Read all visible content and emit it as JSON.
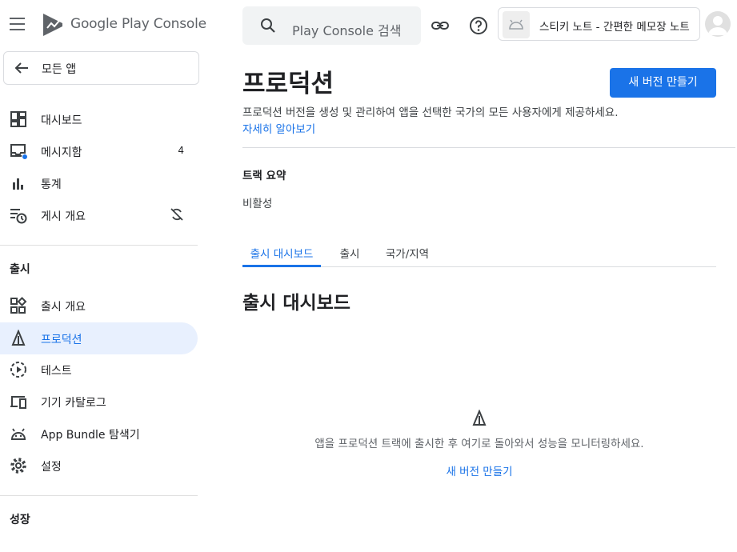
{
  "brand": {
    "name": "Google Play Console"
  },
  "sidebar": {
    "all_apps_label": "모든 앱",
    "top_items": [
      {
        "label": "대시보드",
        "icon": "dashboard-icon"
      },
      {
        "label": "메시지함",
        "icon": "inbox-icon",
        "badge": "4"
      },
      {
        "label": "통계",
        "icon": "bar-chart-icon"
      },
      {
        "label": "게시 개요",
        "icon": "publishing-overview-icon",
        "trailing_icon": "sync-off-icon"
      }
    ],
    "release_section_label": "출시",
    "release_items": [
      {
        "label": "출시 개요",
        "icon": "release-overview-icon"
      },
      {
        "label": "프로덕션",
        "icon": "production-icon",
        "active": true
      },
      {
        "label": "테스트",
        "icon": "testing-icon"
      },
      {
        "label": "기기 카탈로그",
        "icon": "device-catalog-icon"
      },
      {
        "label": "App Bundle 탐색기",
        "icon": "android-icon"
      },
      {
        "label": "설정",
        "icon": "settings-icon"
      }
    ],
    "growth_section_label": "성장"
  },
  "topbar": {
    "search_placeholder": "Play Console 검색",
    "app_name": "스티키 노트 - 간편한 메모장 노트"
  },
  "main": {
    "title": "프로덕션",
    "create_release_label": "새 버전 만들기",
    "description": "프로덕션 버전을 생성 및 관리하여 앱을 선택한 국가의 모든 사용자에게 제공하세요.",
    "learn_more": "자세히 알아보기",
    "track_summary_label": "트랙 요약",
    "track_summary_value": "비활성",
    "tabs": [
      {
        "label": "출시 대시보드",
        "active": true
      },
      {
        "label": "출시"
      },
      {
        "label": "국가/지역"
      }
    ],
    "section_title": "출시 대시보드",
    "empty_message": "앱을 프로덕션 트랙에 출시한 후 여기로 돌아와서 성능을 모니터링하세요.",
    "empty_link": "새 버전 만들기"
  },
  "colors": {
    "accent": "#1a73e8",
    "active_bg": "#e8f0fe",
    "notification_dot": "#1a73e8"
  }
}
